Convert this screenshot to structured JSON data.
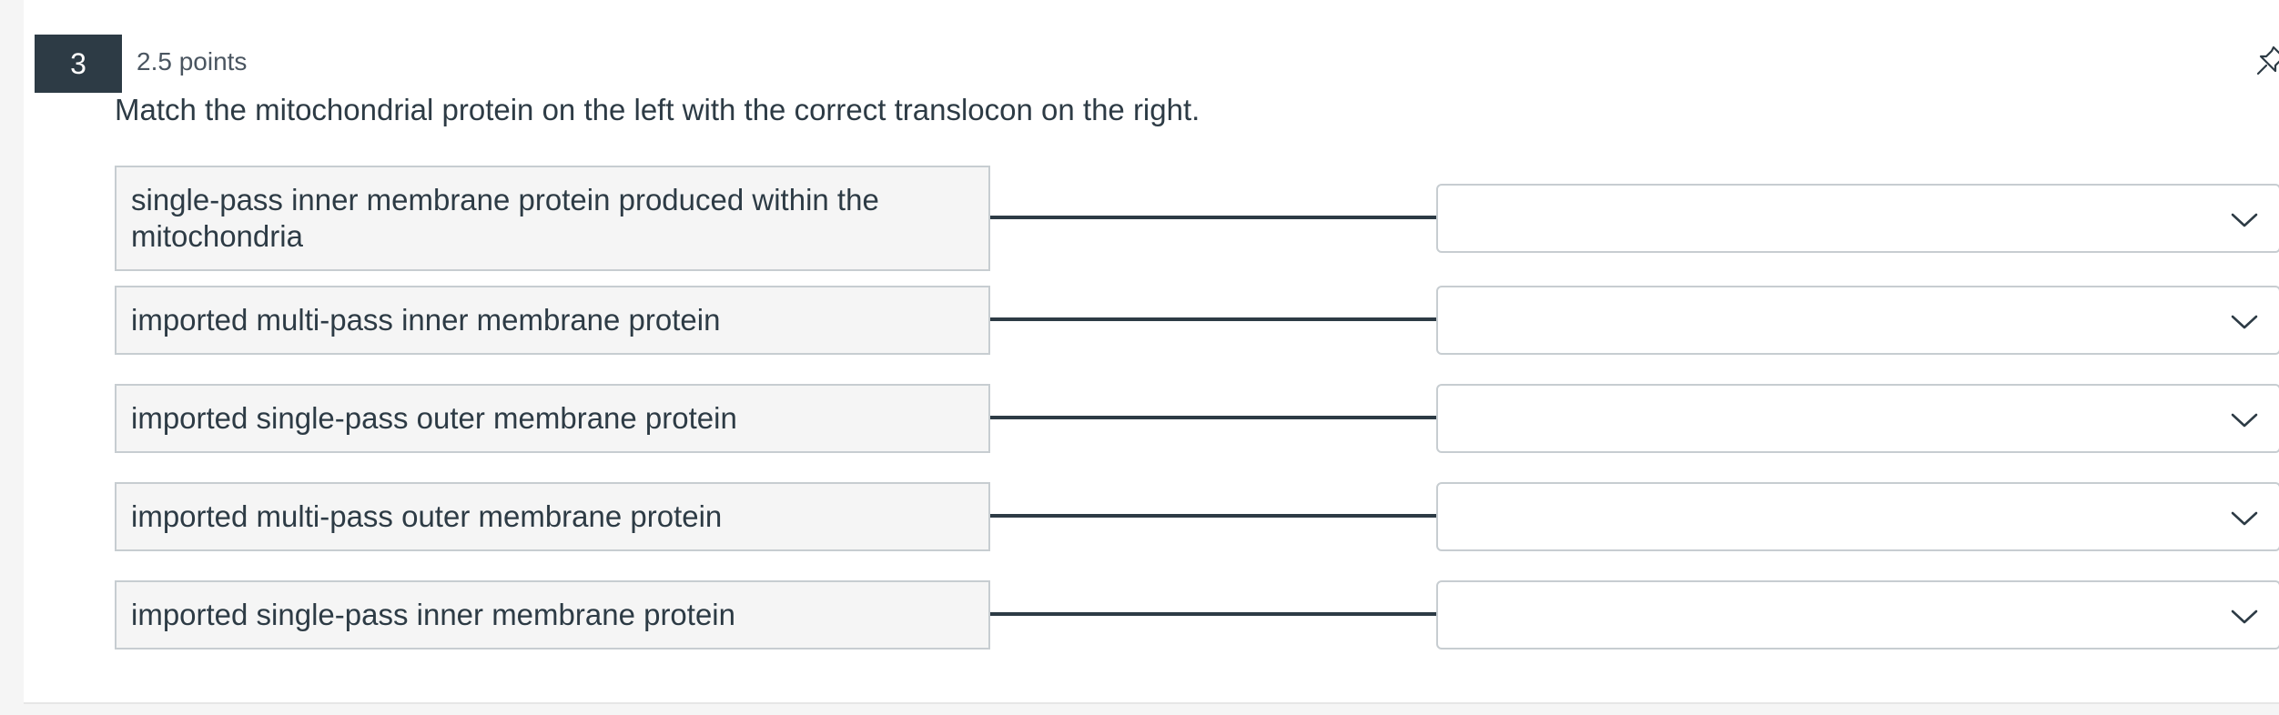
{
  "question": {
    "number": "3",
    "points": "2.5 points",
    "text": "Match the mitochondrial protein on the left with the correct translocon on the right."
  },
  "icons": {
    "pin": "pin-icon",
    "dropdown": "chevron-down-icon"
  },
  "colors": {
    "badge": "#2d3b45",
    "text": "#2d3b45",
    "prompt_bg": "#f5f5f5",
    "border": "#c7cdd1"
  },
  "matches": [
    {
      "prompt": "single-pass inner membrane protein produced within the mitochondria",
      "selected": ""
    },
    {
      "prompt": "imported multi-pass inner membrane protein",
      "selected": ""
    },
    {
      "prompt": "imported single-pass outer membrane protein",
      "selected": ""
    },
    {
      "prompt": "imported multi-pass outer membrane protein",
      "selected": ""
    },
    {
      "prompt": "imported single-pass inner membrane protein",
      "selected": ""
    }
  ]
}
